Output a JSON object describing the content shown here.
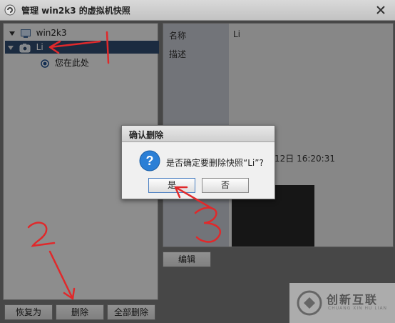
{
  "window": {
    "title": "管理 win2k3 的虚拟机快照"
  },
  "tree": {
    "root_label": "win2k3",
    "snapshot_label": "Li",
    "you_are_here": "您在此处"
  },
  "details": {
    "name_label": "名称",
    "name_value": "Li",
    "desc_label": "描述",
    "date_partial": "12日 16:20:31",
    "edit_button": "编辑"
  },
  "buttons": {
    "revert": "恢复为",
    "delete": "删除",
    "delete_all": "全部删除"
  },
  "dialog": {
    "title": "确认删除",
    "message": "是否确定要删除快照“Li”?",
    "yes": "是",
    "no": "否"
  },
  "annotations": {
    "one": "1",
    "two": "2",
    "three": "3"
  },
  "watermark": {
    "cn": "创新互联",
    "en": "CHUANG XIN HU LIAN"
  },
  "colors": {
    "selection": "#2f4a6e",
    "annotation": "#e0292b",
    "label_column": "#c5c9d1"
  }
}
